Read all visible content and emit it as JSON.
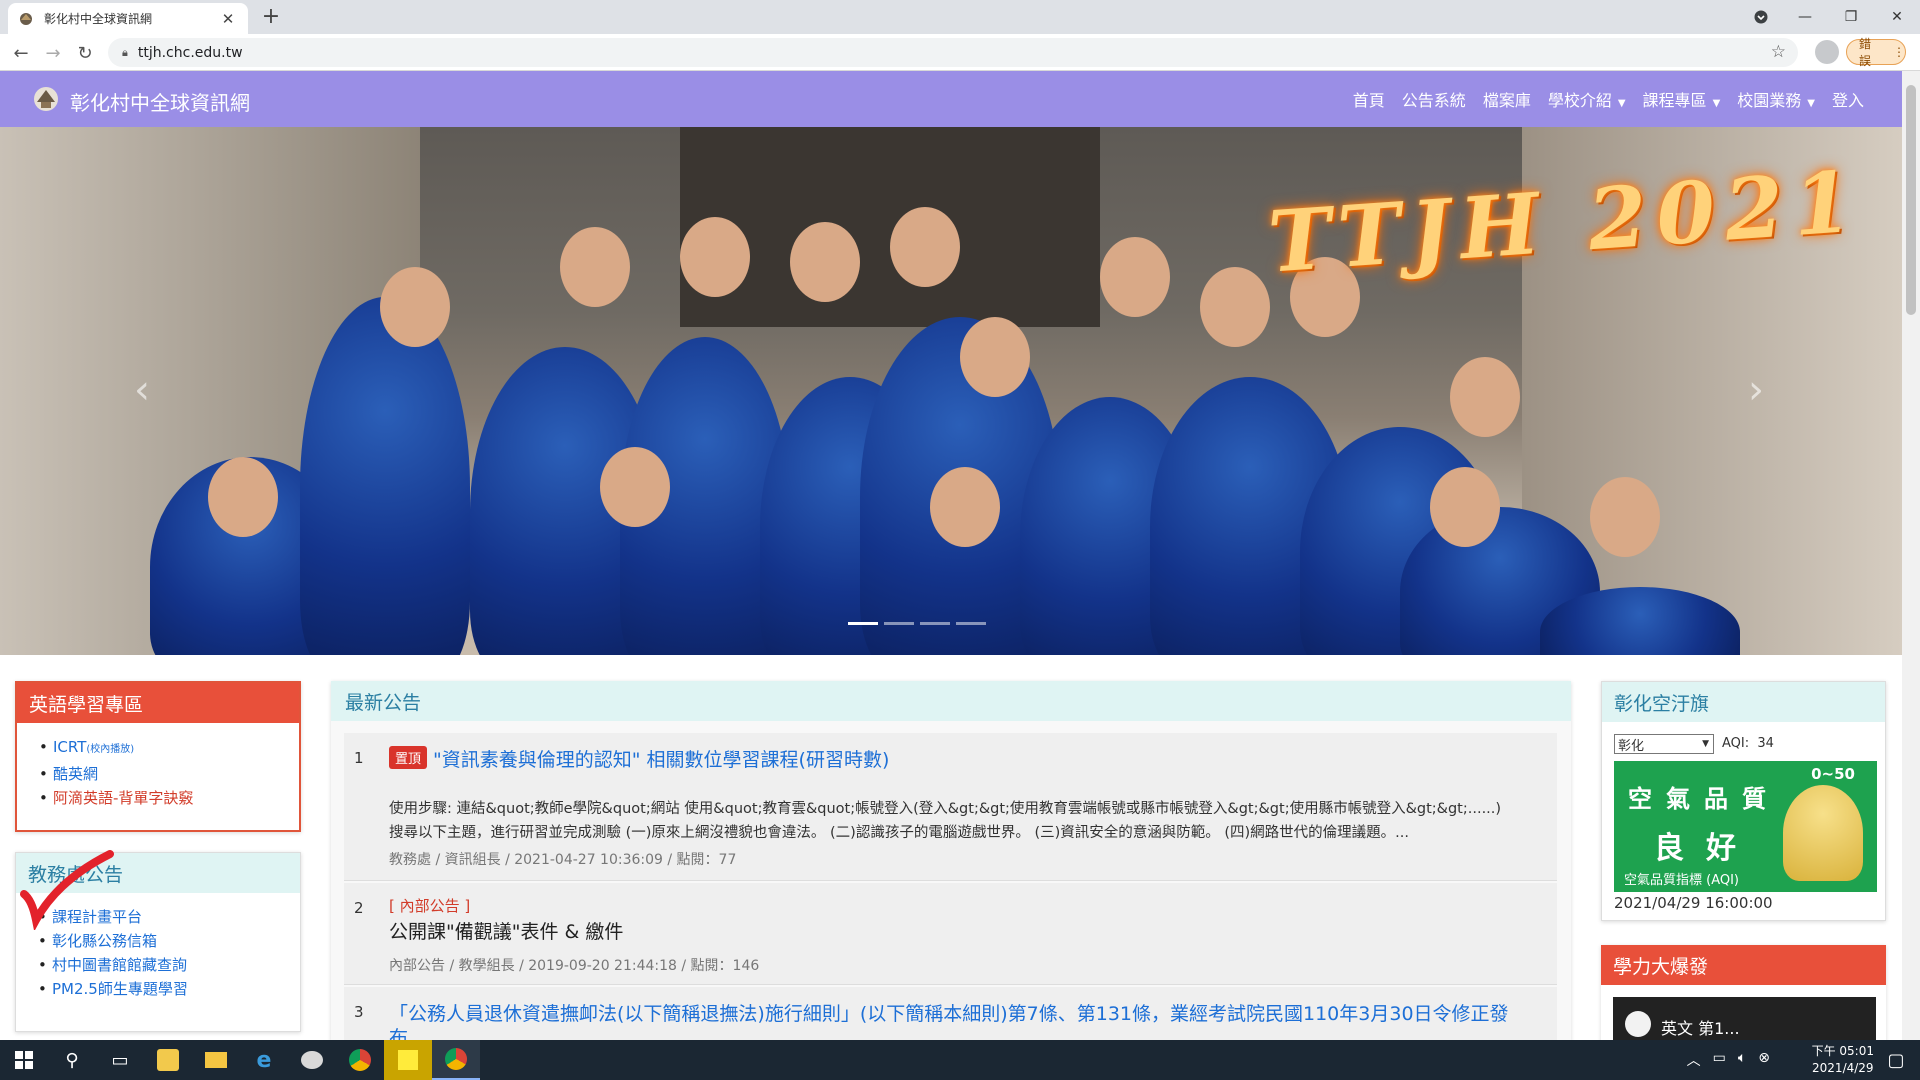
{
  "browser": {
    "tab_title": "彰化村中全球資訊網",
    "url": "ttjh.chc.edu.tw",
    "error_button": "錯誤"
  },
  "site": {
    "brand": "彰化村中全球資訊網",
    "menu": [
      {
        "label": "首頁"
      },
      {
        "label": "公告系統"
      },
      {
        "label": "檔案庫"
      },
      {
        "label": "學校介紹",
        "dropdown": true
      },
      {
        "label": "課程專區",
        "dropdown": true
      },
      {
        "label": "校園業務",
        "dropdown": true
      },
      {
        "label": "登入"
      }
    ]
  },
  "hero": {
    "overlay_text": "TTJH 2021",
    "slides": 4,
    "active_slide": 1
  },
  "english_zone": {
    "title": "英語學習專區",
    "links": [
      {
        "label": "ICRT",
        "suffix": "(校內播放)"
      },
      {
        "label": "酷英網"
      },
      {
        "label": "阿滴英語-背單字訣竅"
      }
    ]
  },
  "academic": {
    "title": "教務處公告",
    "links": [
      {
        "label": "課程計畫平台"
      },
      {
        "label": "彰化縣公務信箱"
      },
      {
        "label": "村中圖書館館藏查詢"
      },
      {
        "label": "PM2.5師生專題學習"
      }
    ]
  },
  "news": {
    "title": "最新公告",
    "items": [
      {
        "num": "1",
        "badge": "置頂",
        "title": "\"資訊素養與倫理的認知\" 相關數位學習課程(研習時數)",
        "desc1": "使用步驟: 連結&quot;教師e學院&quot;網站 使用&quot;教育雲&quot;帳號登入(登入&gt;&gt;使用教育雲端帳號或縣市帳號登入&gt;&gt;使用縣市帳號登入&gt;&gt;......)",
        "desc2": "搜尋以下主題，進行研習並完成測驗 (一)原來上網沒禮貌也會違法。 (二)認識孩子的電腦遊戲世界。 (三)資訊安全的意涵與防範。 (四)網路世代的倫理議題。...",
        "meta": "教務處 / 資訊組長 / 2021-04-27 10:36:09 / 點閱：77"
      },
      {
        "num": "2",
        "tag": "[ 內部公告 ]",
        "title": "公開課\"備觀議\"表件 & 繳件",
        "meta": "內部公告 / 教學組長 / 2019-09-20 21:44:18 / 點閱：146"
      },
      {
        "num": "3",
        "title": "「公務人員退休資遣撫卹法(以下簡稱退撫法)施行細則」(以下簡稱本細則)第7條、第131條，業經考試院民國110年3月30日令修正發",
        "title2": "布"
      }
    ]
  },
  "aqi": {
    "title": "彰化空汙旗",
    "selected_city": "彰化",
    "aqi_label": "AQI:",
    "aqi_value": "34",
    "quality_line1": "空氣品質",
    "quality_line2": "良好",
    "range": "0~50",
    "index_label": "空氣品質指標 (AQI)",
    "time": "2021/04/29 16:00:00"
  },
  "power": {
    "title": "學力大爆發",
    "video_title": "英文 第1..."
  },
  "taskbar": {
    "time": "下午 05:01",
    "date": "2021/4/29"
  },
  "colors": {
    "navbar": "#9a8ee6",
    "red_header": "#e8503a",
    "teal_header": "#dff4f3",
    "link_blue": "#1d6fd6"
  }
}
